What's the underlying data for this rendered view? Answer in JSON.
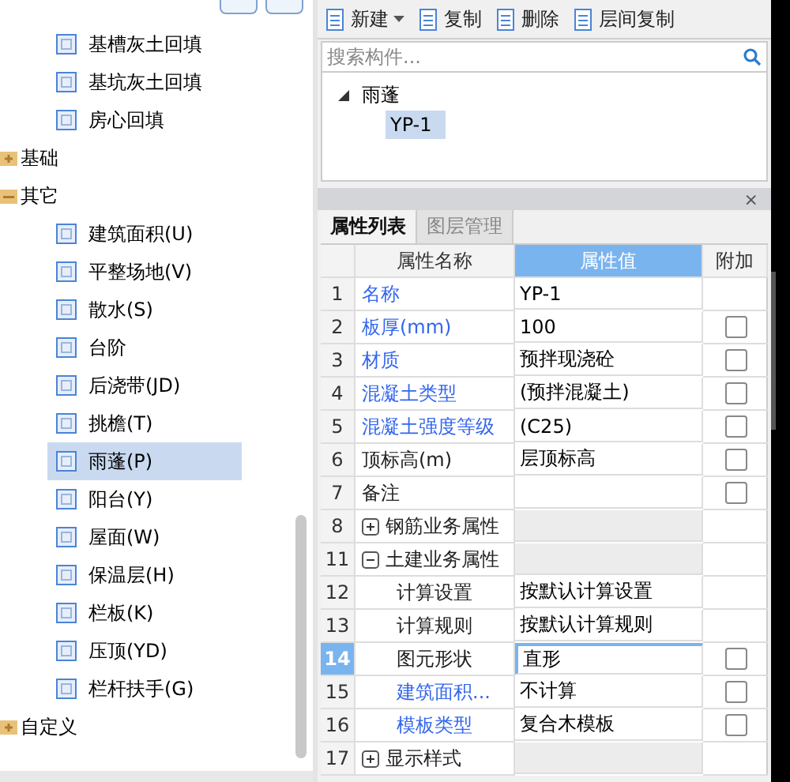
{
  "nav_tree": [
    {
      "children": [
        {
          "label": "基槽灰土回填",
          "selected": false
        },
        {
          "label": "基坑灰土回填",
          "selected": false
        },
        {
          "label": "房心回填",
          "selected": false
        }
      ]
    },
    {
      "label": "基础",
      "expanded": false
    },
    {
      "label": "其它",
      "expanded": true,
      "children": [
        {
          "label": "建筑面积(U)",
          "selected": false
        },
        {
          "label": "平整场地(V)",
          "selected": false
        },
        {
          "label": "散水(S)",
          "selected": false
        },
        {
          "label": "台阶",
          "selected": false
        },
        {
          "label": "后浇带(JD)",
          "selected": false
        },
        {
          "label": "挑檐(T)",
          "selected": false
        },
        {
          "label": "雨蓬(P)",
          "selected": true
        },
        {
          "label": "阳台(Y)",
          "selected": false
        },
        {
          "label": "屋面(W)",
          "selected": false
        },
        {
          "label": "保温层(H)",
          "selected": false
        },
        {
          "label": "栏板(K)",
          "selected": false
        },
        {
          "label": "压顶(YD)",
          "selected": false
        },
        {
          "label": "栏杆扶手(G)",
          "selected": false
        }
      ]
    },
    {
      "label": "自定义",
      "expanded": false
    }
  ],
  "toolbar": [
    {
      "label": "新建",
      "dropdown": true
    },
    {
      "label": "复制",
      "dropdown": false
    },
    {
      "label": "删除",
      "dropdown": false
    },
    {
      "label": "层间复制",
      "dropdown": false
    }
  ],
  "search": {
    "placeholder": "搜索构件..."
  },
  "component_tree": [
    {
      "label": "雨蓬",
      "expanded": true,
      "children": [
        {
          "label": "YP-1",
          "selected": true
        }
      ]
    }
  ],
  "panel_close": "×",
  "tabs": [
    {
      "label": "属性列表",
      "selected": true
    },
    {
      "label": "图层管理",
      "selected": false
    }
  ],
  "table": {
    "columns": [
      "属性名称",
      "属性值",
      "附加"
    ],
    "rows": [
      {
        "kind": "prop",
        "num": "1",
        "name": "名称",
        "linked": true,
        "value": "YP-1",
        "selected": false
      },
      {
        "kind": "prop",
        "num": "2",
        "name": "板厚(mm)",
        "linked": true,
        "value": "100",
        "checked": false,
        "selected": false
      },
      {
        "kind": "prop",
        "num": "3",
        "name": "材质",
        "linked": true,
        "value": "预拌现浇砼",
        "checked": false,
        "selected": false
      },
      {
        "kind": "prop",
        "num": "4",
        "name": "混凝土类型",
        "linked": true,
        "value": "(预拌混凝土)",
        "checked": false,
        "selected": false
      },
      {
        "kind": "prop",
        "num": "5",
        "name": "混凝土强度等级",
        "linked": true,
        "value": "(C25)",
        "checked": false,
        "selected": false
      },
      {
        "kind": "prop",
        "num": "6",
        "name": "顶标高(m)",
        "linked": false,
        "value": "层顶标高",
        "checked": false,
        "selected": false
      },
      {
        "kind": "prop",
        "num": "7",
        "name": "备注",
        "linked": false,
        "value": "",
        "checked": false,
        "selected": false
      },
      {
        "kind": "group",
        "num": "8",
        "name": "钢筋业务属性",
        "expanded": false
      },
      {
        "kind": "group",
        "num": "11",
        "name": "土建业务属性",
        "expanded": true,
        "children": [
          {
            "kind": "prop",
            "num": "12",
            "name": "计算设置",
            "linked": false,
            "value": "按默认计算设置",
            "selected": false
          },
          {
            "kind": "prop",
            "num": "13",
            "name": "计算规则",
            "linked": false,
            "value": "按默认计算规则",
            "selected": false
          },
          {
            "kind": "prop",
            "num": "14",
            "name": "图元形状",
            "linked": false,
            "value": "直形",
            "checked": false,
            "selected": true
          },
          {
            "kind": "prop",
            "num": "15",
            "name": "建筑面积...",
            "linked": true,
            "value": "不计算",
            "checked": false,
            "selected": false
          },
          {
            "kind": "prop",
            "num": "16",
            "name": "模板类型",
            "linked": true,
            "value": "复合木模板",
            "checked": false,
            "selected": false
          }
        ]
      },
      {
        "kind": "group",
        "num": "17",
        "name": "显示样式",
        "expanded": false
      }
    ]
  }
}
